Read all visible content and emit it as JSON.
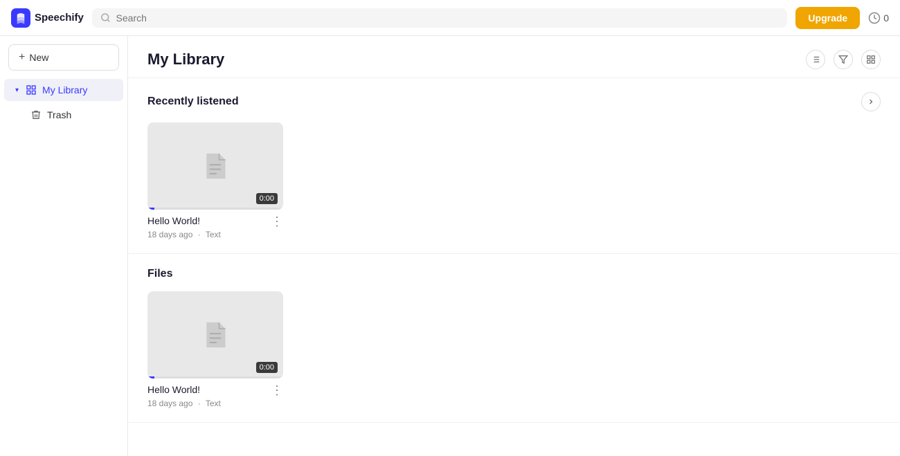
{
  "topbar": {
    "logo_text": "Speechify",
    "search_placeholder": "Search",
    "upgrade_label": "Upgrade",
    "credits": "0"
  },
  "sidebar": {
    "new_button": "New",
    "items": [
      {
        "id": "my-library",
        "label": "My Library",
        "icon": "📊",
        "active": true,
        "has_chevron": true
      },
      {
        "id": "trash",
        "label": "Trash",
        "icon": "🗑",
        "active": false,
        "has_chevron": false
      }
    ]
  },
  "main": {
    "page_title": "My Library",
    "sections": [
      {
        "id": "recently-listened",
        "title": "Recently listened",
        "items": [
          {
            "title": "Hello World!",
            "meta_time": "18 days ago",
            "meta_type": "Text",
            "duration": "0:00",
            "progress": 5
          }
        ]
      },
      {
        "id": "files",
        "title": "Files",
        "items": [
          {
            "title": "Hello World!",
            "meta_time": "18 days ago",
            "meta_type": "Text",
            "duration": "0:00",
            "progress": 5
          }
        ]
      }
    ]
  }
}
